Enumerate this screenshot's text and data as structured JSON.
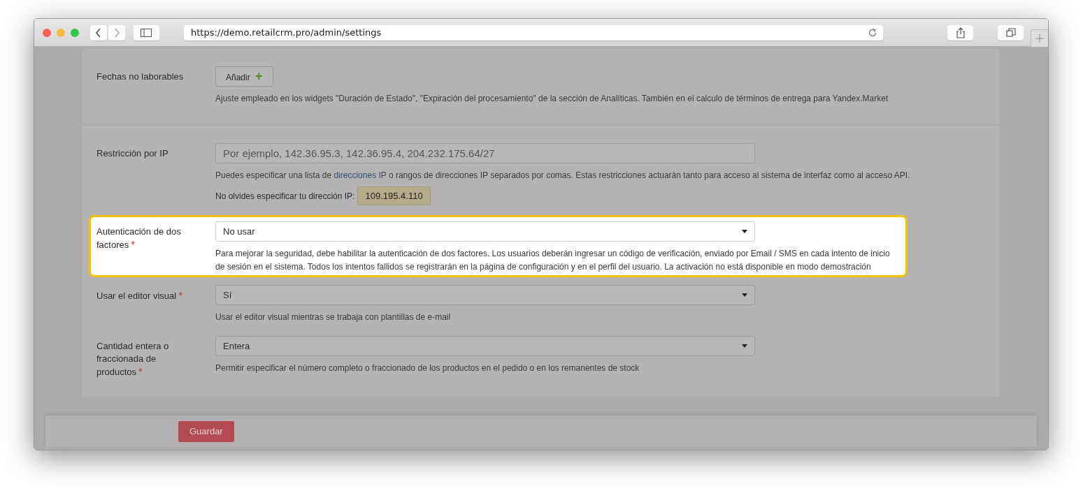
{
  "browser": {
    "url": "https://demo.retailcrm.pro/admin/settings"
  },
  "panels": [
    {
      "rows": [
        {
          "kind": "button",
          "label": "Fechas no laborables",
          "button": "Añadir",
          "icon": "+",
          "highlighted": false,
          "help": [
            {
              "kind": "text",
              "text": "Ajuste empleado en los widgets \"Duración de Estado\", \"Expiración del procesamiento\" de la sección de Analíticas. También en el calculo de términos de entrega para Yandex.Market"
            }
          ]
        }
      ]
    },
    {
      "rows": [
        {
          "kind": "input",
          "label": "Restricción por IP",
          "placeholder": "Por ejemplo, 142.36.95.3, 142.36.95.4, 204.232.175.64/27",
          "highlighted": false,
          "help": [
            {
              "kind": "text",
              "text": "Puedes especificar una lista de "
            },
            {
              "kind": "link",
              "text": "direcciones IP"
            },
            {
              "kind": "text",
              "text": " o rangos de direcciones IP separados por comas. Estas restricciones actuarán tanto para acceso al sistema de interfaz como al acceso API."
            }
          ],
          "note": "No olvides especificar tu dirección IP:",
          "ip": "109.195.4.110"
        },
        {
          "kind": "select",
          "label": "Autenticación de dos factores",
          "required_mark": "*",
          "value": "No usar",
          "highlighted": true,
          "help": [
            {
              "kind": "text",
              "text": "Para mejorar la seguridad, debe habilitar la autenticación de dos factores. Los usuarios deberán ingresar un código de verificación, enviado por Email / SMS en cada intento de inicio de sesión en el sistema. Todos los intentos fallidos se registrarán en la página de configuración y en el perfil del usuario. La activación no está disponible en modo demostración"
            }
          ]
        },
        {
          "kind": "select",
          "label": "Usar el editor visual",
          "required_mark": "*",
          "value": "Sí",
          "highlighted": false,
          "help": [
            {
              "kind": "text",
              "text": "Usar el editor visual mientras se trabaja con plantillas de e-mail"
            }
          ]
        },
        {
          "kind": "select",
          "label": "Cantidad entera o fraccionada de productos",
          "required_mark": "*",
          "value": "Entera",
          "highlighted": false,
          "help": [
            {
              "kind": "text",
              "text": "Permitir especificar el número completo o fraccionado de los productos en el pedido o en los remanentes de stock"
            }
          ]
        }
      ]
    }
  ],
  "footer": {
    "save_button": "Guardar"
  }
}
